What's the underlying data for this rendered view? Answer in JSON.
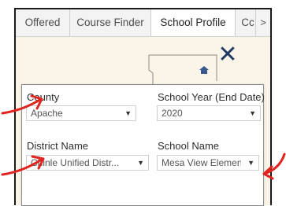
{
  "tabs": [
    {
      "label": "Offered",
      "active": false
    },
    {
      "label": "Course Finder",
      "active": false
    },
    {
      "label": "School Profile",
      "active": true
    },
    {
      "label": "Cc",
      "active": false
    }
  ],
  "tab_scroll_icon": ">",
  "close_icon": "✕",
  "filters": {
    "county": {
      "label": "County",
      "value": "Apache"
    },
    "school_year": {
      "label": "School Year (End Date)",
      "value": "2020"
    },
    "district": {
      "label": "District Name",
      "value": "Chinle Unified Distr..."
    },
    "school": {
      "label": "School Name",
      "value": "Mesa View Element..."
    }
  },
  "colors": {
    "accent_navy": "#1f3a66",
    "annotation_red": "#e0241f",
    "map_background": "#fbf4e8",
    "icon_red": "#c8342a",
    "icon_yellow": "#f2c200"
  },
  "caret_icon": "▼"
}
